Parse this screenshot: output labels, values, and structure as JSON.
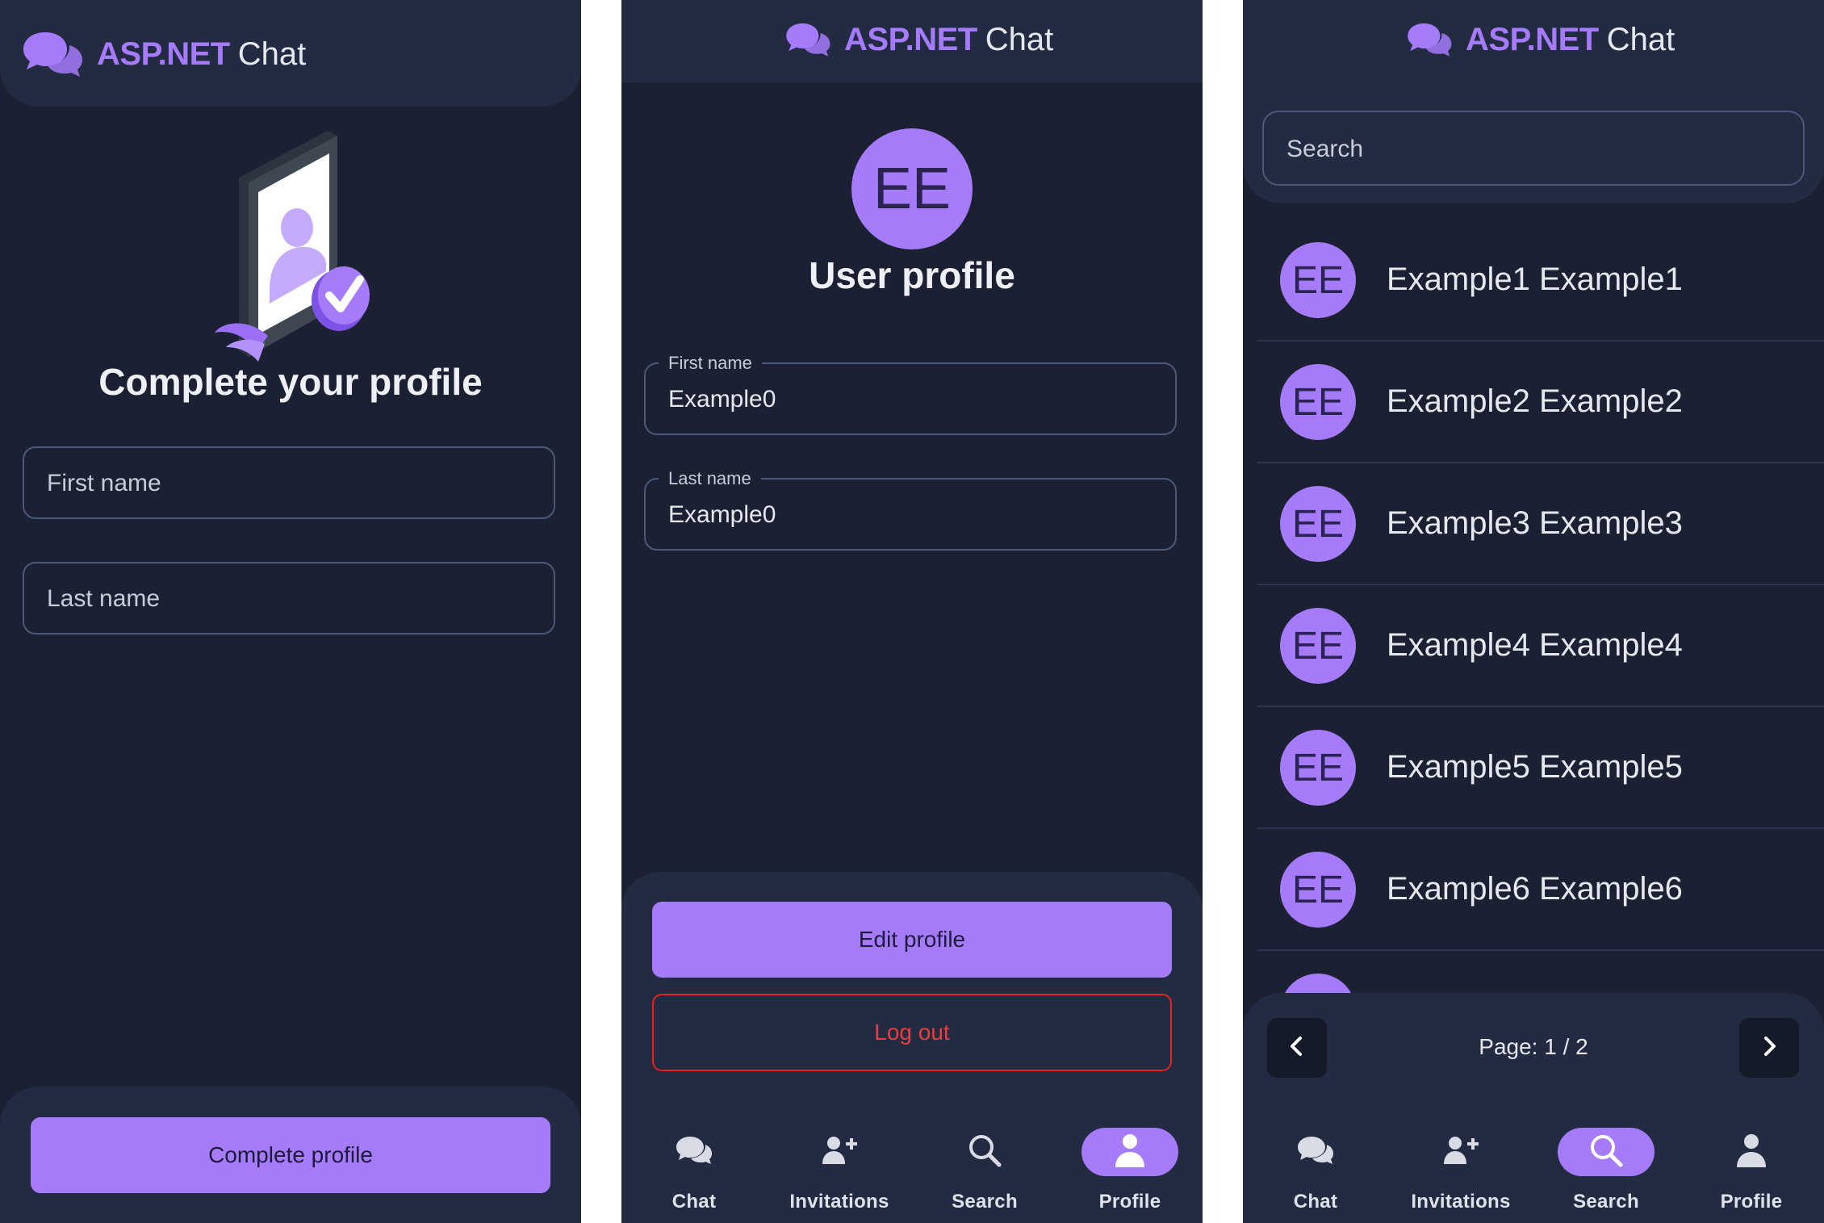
{
  "colors": {
    "accent": "#a57bfa",
    "panel_bg": "#1b2132",
    "surface": "#222b41",
    "danger": "#e02424",
    "text": "#e6e8ef"
  },
  "brand": {
    "bold": "ASP.NET",
    "rest": "Chat",
    "icon": "chat-bubbles-icon"
  },
  "complete_profile_screen": {
    "illustration": "phone-profile-verified-illustration",
    "title": "Complete your profile",
    "first_name_placeholder": "First name",
    "last_name_placeholder": "Last name",
    "submit_label": "Complete profile"
  },
  "user_profile_screen": {
    "avatar_initials": "EE",
    "title": "User profile",
    "first_name_label": "First name",
    "first_name_value": "Example0",
    "last_name_label": "Last name",
    "last_name_value": "Example0",
    "edit_label": "Edit profile",
    "logout_label": "Log out",
    "active_nav": "Profile"
  },
  "search_screen": {
    "search_placeholder": "Search",
    "results": [
      {
        "initials": "EE",
        "name": "Example1 Example1"
      },
      {
        "initials": "EE",
        "name": "Example2 Example2"
      },
      {
        "initials": "EE",
        "name": "Example3 Example3"
      },
      {
        "initials": "EE",
        "name": "Example4 Example4"
      },
      {
        "initials": "EE",
        "name": "Example5 Example5"
      },
      {
        "initials": "EE",
        "name": "Example6 Example6"
      }
    ],
    "pagination": {
      "prefix": "Page:",
      "current": 1,
      "total": 2,
      "text": "Page: 1 / 2"
    },
    "active_nav": "Search"
  },
  "nav": {
    "items": [
      {
        "label": "Chat",
        "icon": "chat-icon"
      },
      {
        "label": "Invitations",
        "icon": "add-person-icon"
      },
      {
        "label": "Search",
        "icon": "search-icon"
      },
      {
        "label": "Profile",
        "icon": "person-icon"
      }
    ]
  }
}
